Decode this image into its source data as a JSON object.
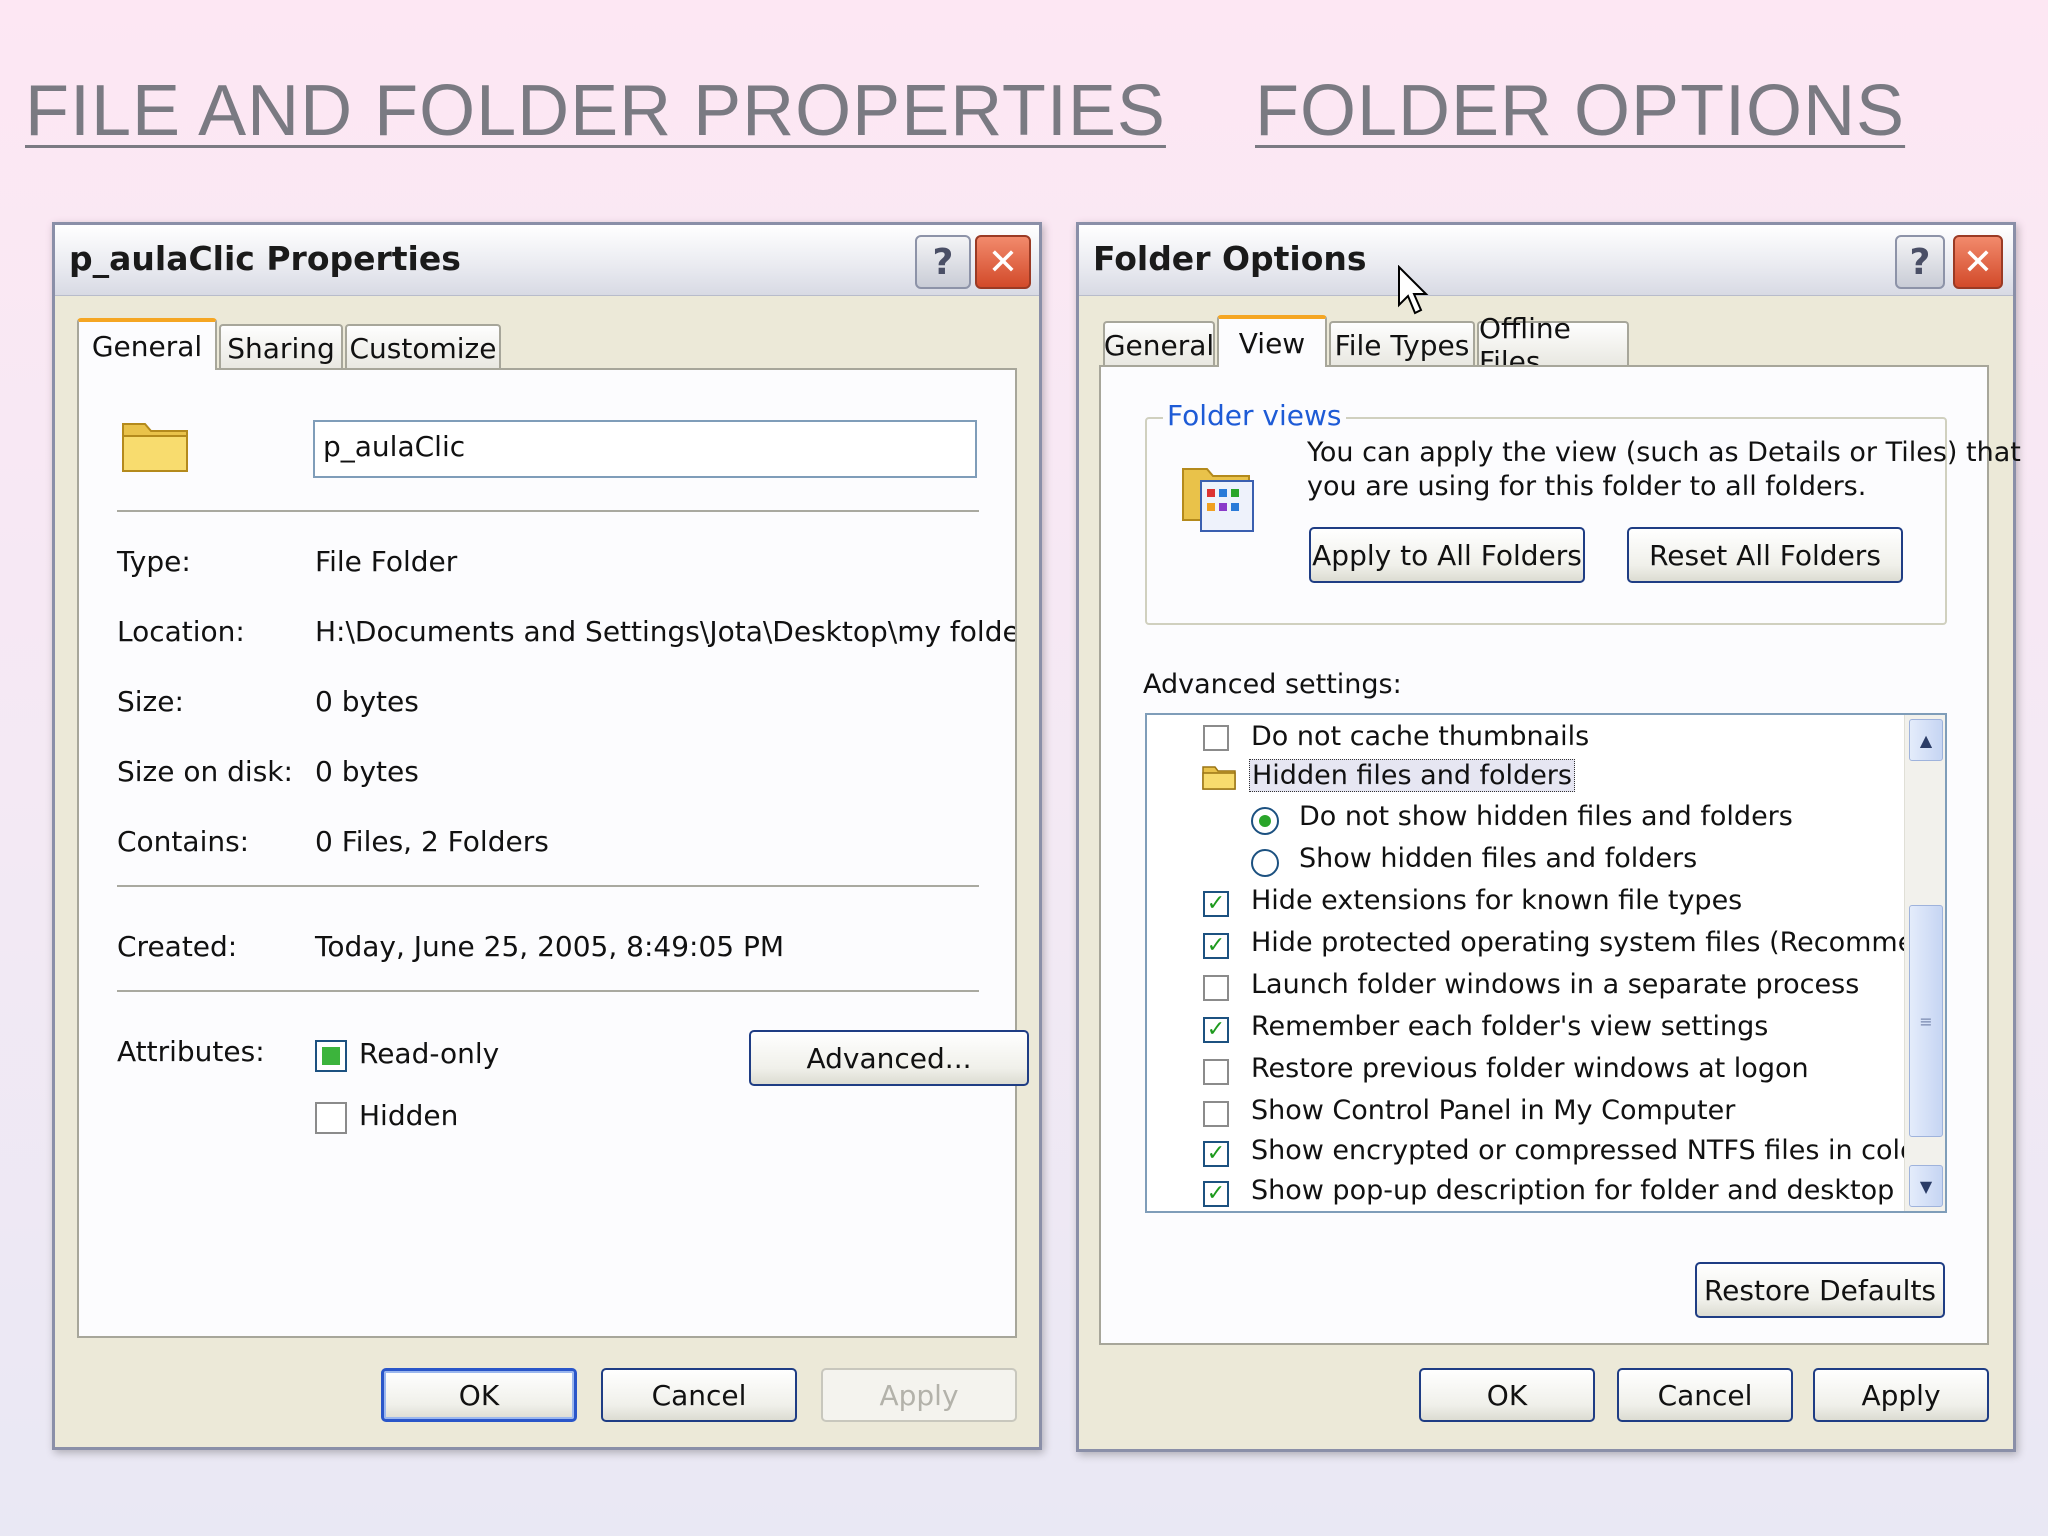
{
  "headings": {
    "left": "FILE AND FOLDER PROPERTIES",
    "right": "FOLDER OPTIONS"
  },
  "properties": {
    "title": "p_aulaClic Properties",
    "tabs": [
      "General",
      "Sharing",
      "Customize"
    ],
    "name_value": "p_aulaClic",
    "fields": [
      {
        "label": "Type:",
        "value": "File Folder"
      },
      {
        "label": "Location:",
        "value": "H:\\Documents and Settings\\Jota\\Desktop\\my folde"
      },
      {
        "label": "Size:",
        "value": "0 bytes"
      },
      {
        "label": "Size on disk:",
        "value": "0 bytes"
      },
      {
        "label": "Contains:",
        "value": "0 Files, 2 Folders"
      }
    ],
    "created_label": "Created:",
    "created_value": "Today, June 25, 2005, 8:49:05 PM",
    "attributes_label": "Attributes:",
    "readonly_label": "Read-only",
    "hidden_label": "Hidden",
    "advanced_button": "Advanced...",
    "ok": "OK",
    "cancel": "Cancel",
    "apply": "Apply"
  },
  "folder_options": {
    "title": "Folder Options",
    "tabs": [
      "General",
      "View",
      "File Types",
      "Offline Files"
    ],
    "group_title": "Folder views",
    "description_line1": "You can apply the view (such as Details or Tiles) that",
    "description_line2": "you are using for this folder to all folders.",
    "apply_all_button": "Apply to All Folders",
    "reset_all_button": "Reset All Folders",
    "advanced_label": "Advanced settings:",
    "settings": {
      "s0": "Do not cache thumbnails",
      "s1": "Hidden files and folders",
      "s2": "Do not show hidden files and folders",
      "s3": "Show hidden files and folders",
      "s4": "Hide extensions for known file types",
      "s5": "Hide protected operating system files (Recommended)",
      "s6": "Launch folder windows in a separate process",
      "s7": "Remember each folder's view settings",
      "s8": "Restore previous folder windows at logon",
      "s9": "Show Control Panel in My Computer",
      "s10": "Show encrypted or compressed NTFS files in color",
      "s11": "Show pop-up description for folder and desktop items"
    },
    "restore_defaults": "Restore Defaults",
    "ok": "OK",
    "cancel": "Cancel",
    "apply": "Apply"
  },
  "colors": {
    "group_title": "#1e5bd6",
    "check": "#1d9a1d",
    "close_button": "#d24a2a",
    "default_button_border": "#2a56c9"
  }
}
